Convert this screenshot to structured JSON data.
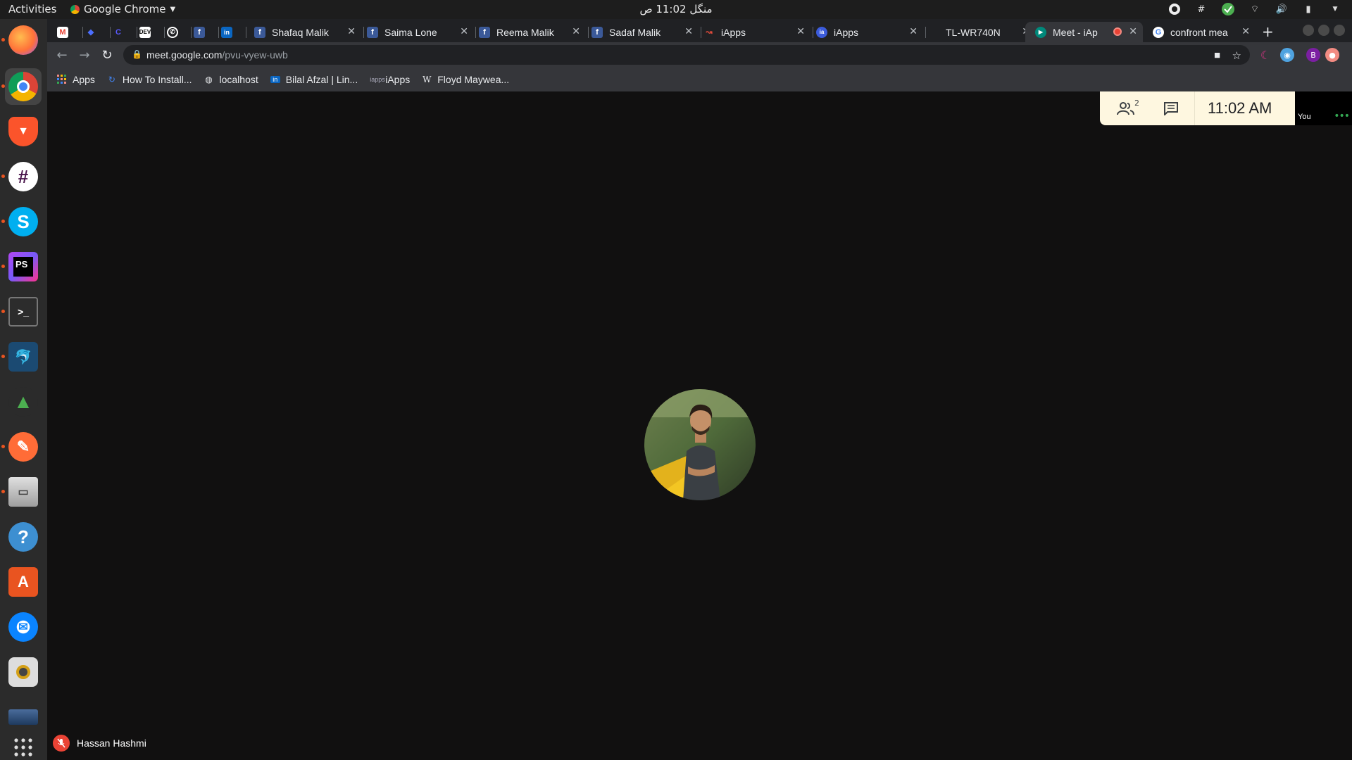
{
  "topbar": {
    "activities": "Activities",
    "app_name": "Google Chrome",
    "clock": "منگل 11:02 ص",
    "tray_icons": [
      "obs-icon",
      "slack-icon",
      "check-icon",
      "wifi-icon",
      "volume-icon",
      "battery-icon",
      "chevron-down-icon"
    ]
  },
  "dock": {
    "items": [
      "firefox",
      "chrome",
      "brave",
      "slack",
      "skype",
      "phpstorm",
      "terminal",
      "mysql-workbench",
      "rocket",
      "postman",
      "files",
      "help",
      "software-center",
      "thunderbird",
      "rhythmbox",
      "screen",
      "show-apps"
    ]
  },
  "tabs": [
    {
      "title": "",
      "icon": "gmail-icon"
    },
    {
      "title": "",
      "icon": "jira-icon"
    },
    {
      "title": "",
      "icon": "clockify-icon"
    },
    {
      "title": "",
      "icon": "dev-icon"
    },
    {
      "title": "",
      "icon": "whatsapp-icon"
    },
    {
      "title": "",
      "icon": "facebook-icon"
    },
    {
      "title": "",
      "icon": "linkedin-icon"
    },
    {
      "title": "Shafaq Malik",
      "icon": "facebook-icon"
    },
    {
      "title": "Saima Lone",
      "icon": "facebook-icon"
    },
    {
      "title": "Reema Malik",
      "icon": "facebook-icon"
    },
    {
      "title": "Sadaf Malik",
      "icon": "facebook-icon"
    },
    {
      "title": "iApps",
      "icon": "iapps-icon"
    },
    {
      "title": "iApps",
      "icon": "iapps-icon"
    },
    {
      "title": "TL-WR740N",
      "icon": ""
    },
    {
      "title": "Meet - iAp",
      "icon": "meet-icon"
    },
    {
      "title": "confront mea",
      "icon": "google-icon"
    }
  ],
  "address": {
    "host": "meet.google.com",
    "path": "/pvu-vyew-uwb"
  },
  "bookmarks": [
    {
      "label": "Apps",
      "icon": "apps-grid-icon"
    },
    {
      "label": "How To Install...",
      "icon": "bookmark-icon"
    },
    {
      "label": "localhost",
      "icon": "globe-icon"
    },
    {
      "label": "Bilal Afzal | Lin...",
      "icon": "linkedin-icon"
    },
    {
      "label": "iApps",
      "icon": "iapps-icon"
    },
    {
      "label": "Floyd Maywea...",
      "icon": "wikipedia-icon"
    }
  ],
  "meet": {
    "participants_count": "2",
    "time": "11:02  AM",
    "self_label": "You",
    "participant_name": "Hassan Hashmi"
  },
  "colors": {
    "meeting_bg": "#111010",
    "info_panel": "#fef7e0",
    "muted_red": "#ea4335",
    "ubuntu_orange": "#e95420"
  }
}
